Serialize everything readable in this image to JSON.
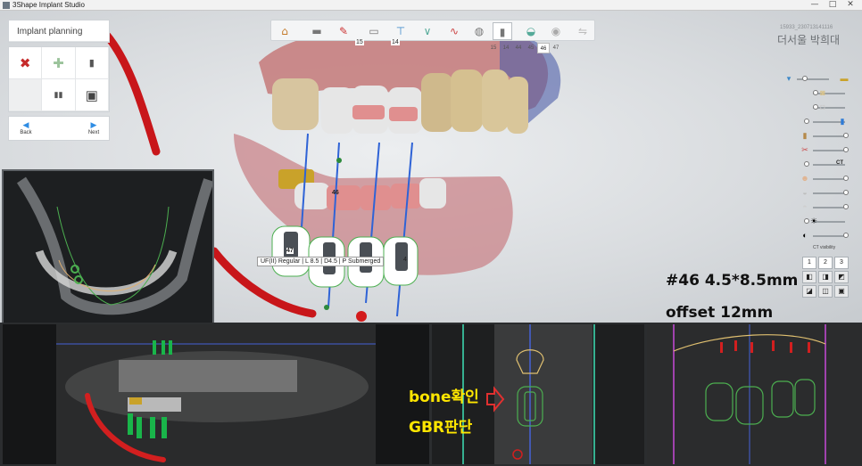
{
  "window": {
    "app_title": "3Shape Implant Studio",
    "controls": [
      "—",
      "□",
      "✕"
    ]
  },
  "panel": {
    "title": "Implant planning",
    "tools": [
      {
        "name": "delete-tool",
        "glyph": "✖",
        "color": "#c62b2b"
      },
      {
        "name": "add-tool",
        "glyph": "✚",
        "color": "#9bc39b"
      },
      {
        "name": "implant-tool",
        "glyph": "▮",
        "color": "#555555"
      },
      {
        "name": "empty-tool",
        "glyph": "",
        "color": "#ffffff"
      },
      {
        "name": "abutment-tool",
        "glyph": "▮▮",
        "color": "#555555"
      },
      {
        "name": "sleeve-tool",
        "glyph": "▣",
        "color": "#444444"
      }
    ],
    "back_label": "Back",
    "next_label": "Next"
  },
  "toolbar": {
    "icons": [
      "home-icon",
      "panorama-icon",
      "tooth-check-icon",
      "scan-icon",
      "crown-icon",
      "drill-icon",
      "nerve-icon",
      "tooth-model-icon",
      "implant-icon",
      "abutment-icon",
      "sphere-icon",
      "arrows-icon"
    ],
    "badge_left": "15",
    "badge_right": "14",
    "tooth_tabs": [
      "15",
      "14",
      "44",
      "45",
      "46",
      "47"
    ],
    "selected_tab": "46"
  },
  "patient": {
    "id": "15933_230713141116",
    "name": "더서울 박희대"
  },
  "sliders": [
    {
      "icon": "tooth-gold-icon",
      "color": "#c9a22a",
      "level": 0.85
    },
    {
      "icon": "crown-beige-icon",
      "color": "#d8c28a",
      "level": 0.85
    },
    {
      "icon": "tooth-white-icon",
      "color": "#dddddd",
      "level": 0.85
    },
    {
      "icon": "implant-blue-icon",
      "color": "#2f7bd6",
      "level": 0.85
    },
    {
      "icon": "bone-icon",
      "color": "#b58a4a",
      "level": 0.1
    },
    {
      "icon": "nerve-icon",
      "color": "#c94a4a",
      "level": 0.1
    },
    {
      "icon": "ct-icon",
      "color": "#222222",
      "level": 0.1,
      "label": "CT"
    },
    {
      "icon": "skin-icon",
      "color": "#e0b38f",
      "level": 0.1
    },
    {
      "icon": "tooth-gray-icon",
      "color": "#bdbdbd",
      "level": 0.1
    },
    {
      "icon": "jaw-icon",
      "color": "#cfcfcf",
      "level": 0.1
    },
    {
      "icon": "brightness-icon",
      "color": "#222222",
      "level": 0.1,
      "glyph": "☀"
    },
    {
      "icon": "contrast-icon",
      "color": "#222222",
      "level": 0.1,
      "glyph": "◐"
    }
  ],
  "ct_visibility": {
    "label": "CT visibility",
    "numbers": [
      "1",
      "2",
      "3"
    ]
  },
  "annotations": {
    "implant_spec": "#46 4.5*8.5mm",
    "offset": "offset 12mm",
    "bone_check": "bone확인",
    "gbr": "GBR판단"
  },
  "implant_tooltip": "UF(II) Regular | L 8.5 | D4.5 | P Submerged",
  "implant_labels": [
    "46",
    "47",
    "4"
  ],
  "colors": {
    "gum": "#c77f7f",
    "implant_red": "#e06a6a",
    "nerve": "#d21f1f",
    "guide_blue": "#2f63d6",
    "annotation_yellow": "#ffe600"
  }
}
